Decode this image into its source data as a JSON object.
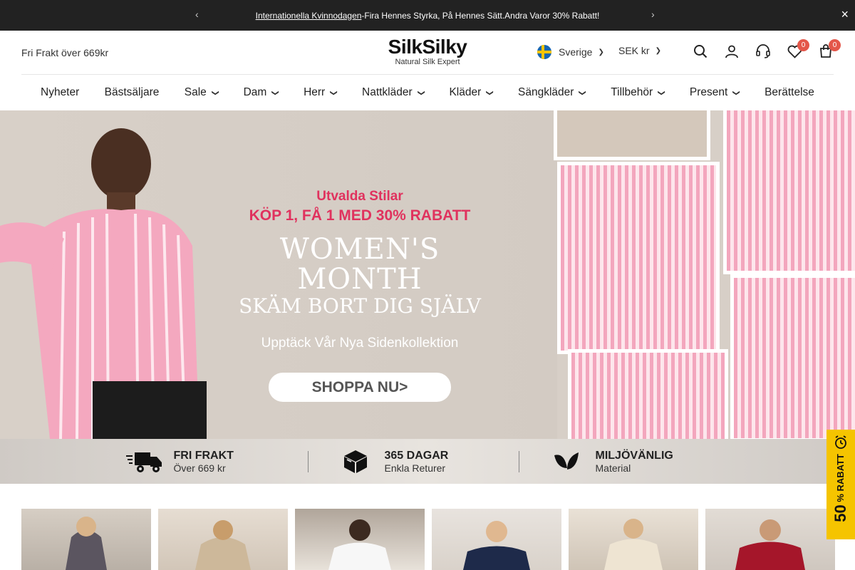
{
  "announcement": {
    "link_text": "Internationella Kvinnodagen",
    "text": "-Fira Hennes Styrka, På Hennes Sätt.Andra Varor 30% Rabatt!"
  },
  "header": {
    "shipping_text": "Fri Frakt över 669kr",
    "logo_main": "SilkSilky",
    "logo_sub": "Natural Silk Expert",
    "country": "Sverige",
    "currency": "SEK kr",
    "wishlist_count": "0",
    "cart_count": "0"
  },
  "nav": {
    "items": [
      {
        "label": "Nyheter",
        "dropdown": false
      },
      {
        "label": "Bästsäljare",
        "dropdown": false
      },
      {
        "label": "Sale",
        "dropdown": true
      },
      {
        "label": "Dam",
        "dropdown": true
      },
      {
        "label": "Herr",
        "dropdown": true
      },
      {
        "label": "Nattkläder",
        "dropdown": true
      },
      {
        "label": "Kläder",
        "dropdown": true
      },
      {
        "label": "Sängkläder",
        "dropdown": true
      },
      {
        "label": "Tillbehör",
        "dropdown": true
      },
      {
        "label": "Present",
        "dropdown": true
      },
      {
        "label": "Berättelse",
        "dropdown": false
      }
    ]
  },
  "hero": {
    "kicker": "Utvalda Stilar",
    "offer": "KÖP 1, FÅ 1 MED 30% RABATT",
    "title": "WOMEN'S MONTH",
    "tagline": "SKÄM BORT DIG SJÄLV",
    "discover": "Upptäck Vår Nya Sidenkollektion",
    "cta": "SHOPPA NU>"
  },
  "usps": [
    {
      "title": "FRI FRAKT",
      "subtitle": "Över 669 kr",
      "icon": "truck-icon"
    },
    {
      "title": "365 DAGAR",
      "subtitle": "Enkla Returer",
      "icon": "box-icon"
    },
    {
      "title": "MILJÖVÄNLIG",
      "subtitle": "Material",
      "icon": "leaf-icon"
    }
  ],
  "discount_tab": {
    "amount": "50",
    "label": "% RABATT"
  },
  "colors": {
    "accent_pink": "#e0325e",
    "badge_red": "#e4574a",
    "discount_yellow": "#f5c400",
    "announcement_bg": "#222222"
  }
}
